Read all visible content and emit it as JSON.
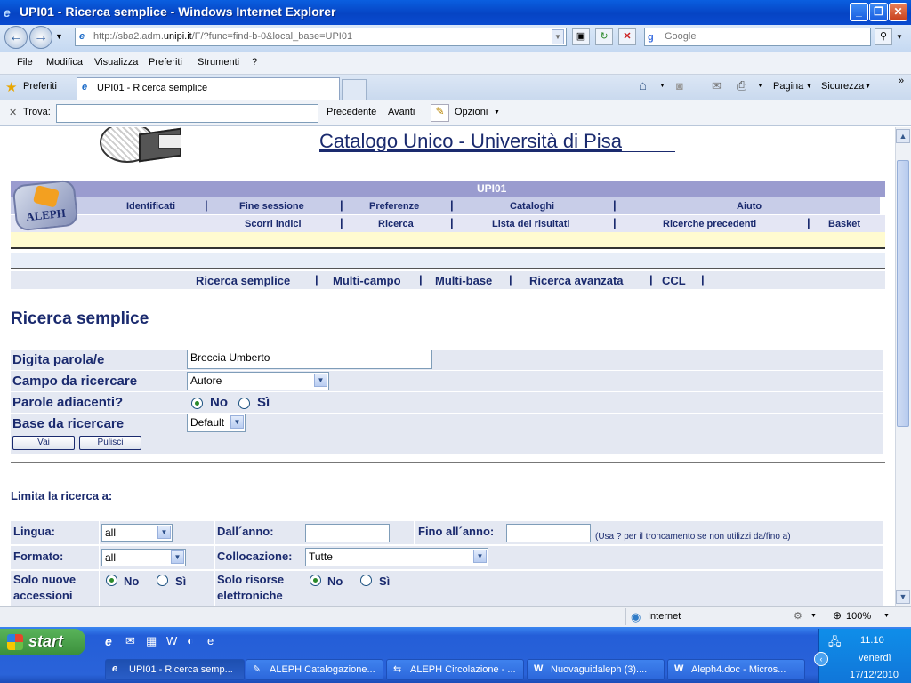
{
  "window": {
    "title": "UPI01 - Ricerca semplice - Windows Internet Explorer"
  },
  "address_bar": {
    "url_prefix": "http://sba2.adm.",
    "url_domain": "unipi.it",
    "url_suffix": "/F/?func=find-b-0&local_base=UPI01",
    "search_placeholder": "Google"
  },
  "menu": {
    "items": [
      "File",
      "Modifica",
      "Visualizza",
      "Preferiti",
      "Strumenti",
      "?"
    ]
  },
  "favorites_bar": {
    "favorites_label": "Preferiti",
    "tab_title": "UPI01 - Ricerca semplice",
    "tools": {
      "page": "Pagina",
      "security": "Sicurezza"
    }
  },
  "find_bar": {
    "label": "Trova:",
    "prev": "Precedente",
    "next": "Avanti",
    "options": "Opzioni"
  },
  "page": {
    "site_title": "Catalogo Unico - Università di Pisa",
    "logo_text": "ALEPH",
    "base_label": "UPI01",
    "top_menu": [
      "Identificati",
      "Fine sessione",
      "Preferenze",
      "Cataloghi",
      "Aiuto"
    ],
    "sub_menu": [
      "Scorri indici",
      "Ricerca",
      "Lista dei risultati",
      "Ricerche precedenti",
      "Basket"
    ],
    "search_tabs": [
      "Ricerca semplice",
      "Multi-campo",
      "Multi-base",
      "Ricerca avanzata",
      "CCL"
    ],
    "heading": "Ricerca semplice",
    "form": {
      "words_label": "Digita parola/e",
      "words_value": "Breccia Umberto",
      "field_label": "Campo da ricercare",
      "field_value": "Autore",
      "adjacent_label": "Parole adiacenti?",
      "no_label": "No",
      "yes_label": "Sì",
      "base_label": "Base da ricercare",
      "base_value": "Default",
      "go_button": "Vai",
      "clear_button": "Pulisci"
    },
    "limit": {
      "title": "Limita la ricerca a:",
      "language_label": "Lingua:",
      "language_value": "all",
      "from_year_label": "Dall´anno:",
      "to_year_label": "Fino all´anno:",
      "year_hint": "(Usa ? per il troncamento se non utilizzi da/fino a)",
      "format_label": "Formato:",
      "format_value": "all",
      "location_label": "Collocazione:",
      "location_value": "Tutte",
      "new_acc_label_1": "Solo nuove",
      "new_acc_label_2": "accessioni",
      "e_res_label_1": "Solo risorse",
      "e_res_label_2": "elettroniche",
      "no_label": "No",
      "yes_label": "Sì"
    }
  },
  "status_bar": {
    "zone": "Internet",
    "zoom": "100%"
  },
  "taskbar": {
    "start": "start",
    "tasks": [
      "UPI01 - Ricerca semp...",
      "ALEPH Catalogazione...",
      "ALEPH Circolazione - ...",
      "Nuovaguidaleph (3)....",
      "Aleph4.doc - Micros..."
    ],
    "clock": {
      "time": "11.10",
      "day": "venerdì",
      "date": "17/12/2010"
    }
  }
}
